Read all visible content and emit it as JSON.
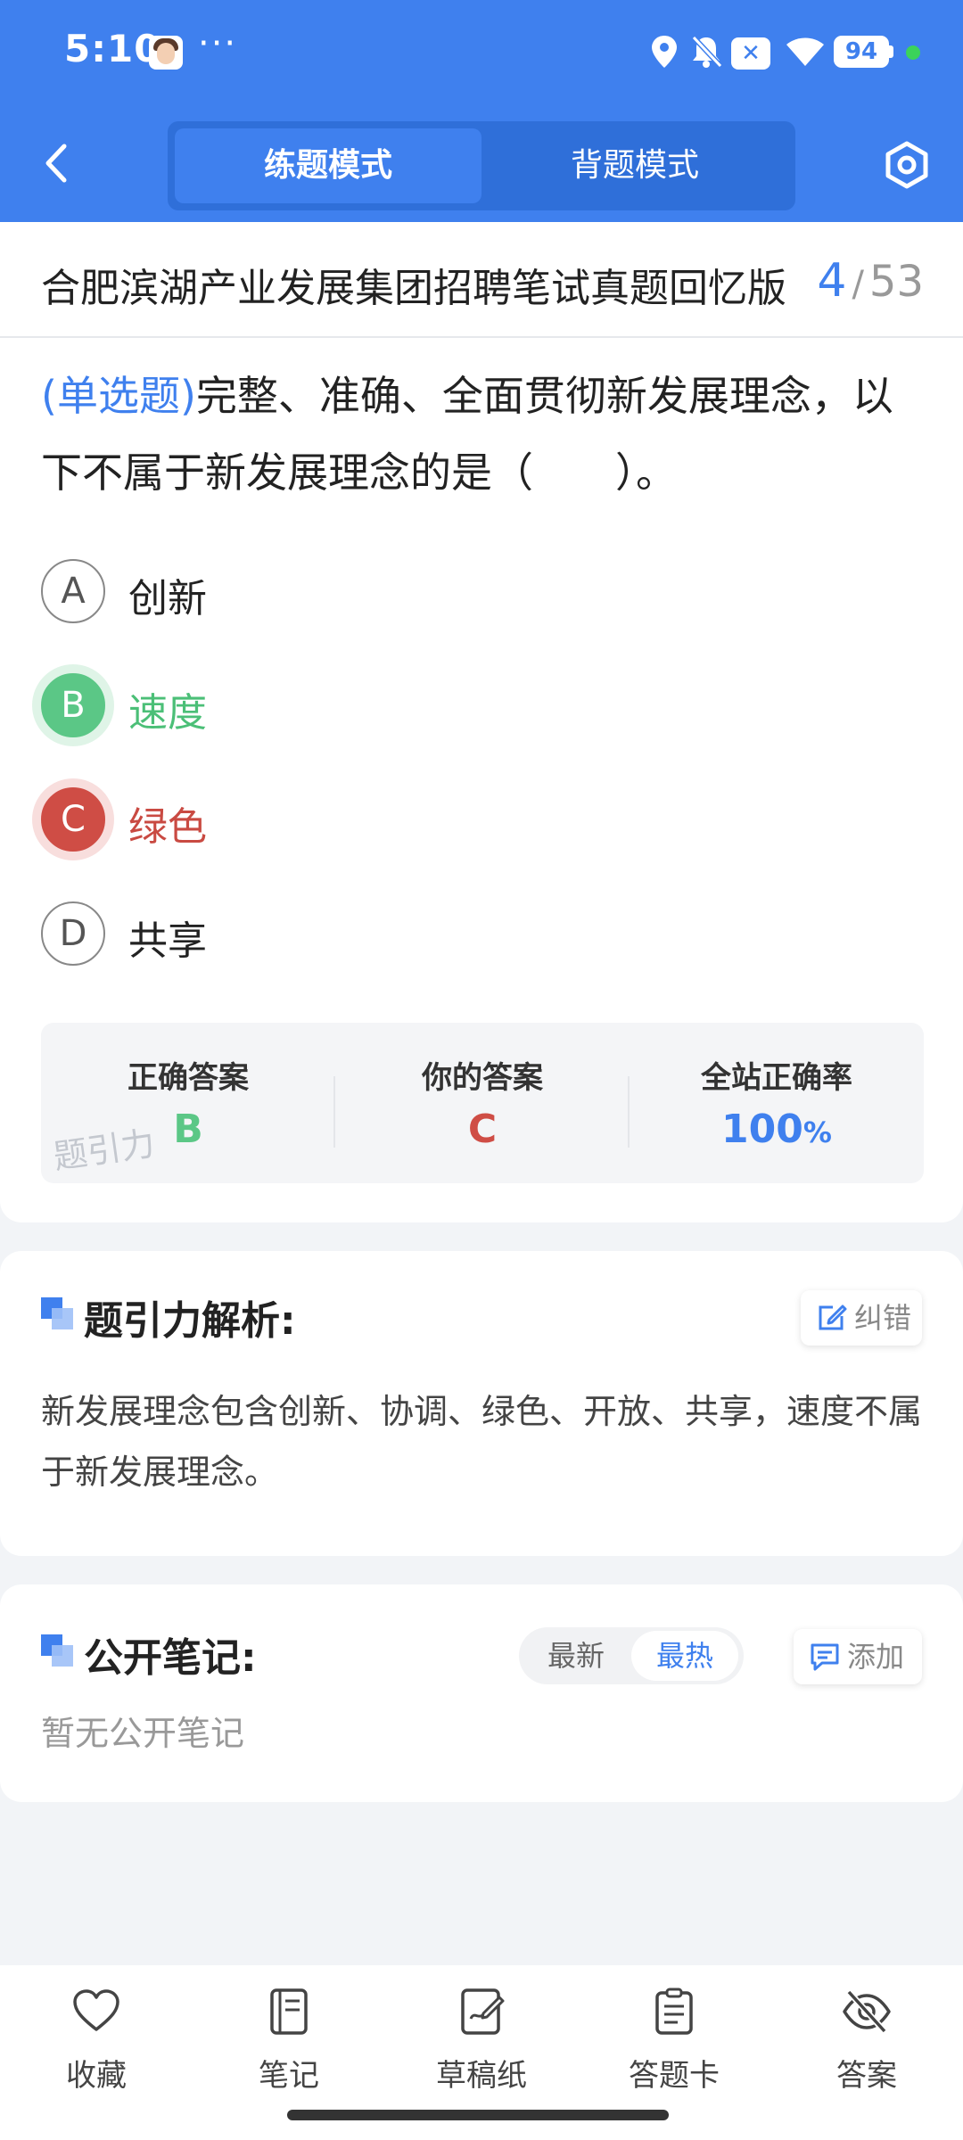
{
  "status_bar": {
    "time": "5:10",
    "more": "···",
    "x_badge": "✕",
    "battery": "94"
  },
  "header": {
    "tabs": [
      {
        "label": "练题模式",
        "active": true
      },
      {
        "label": "背题模式",
        "active": false
      }
    ]
  },
  "question_card": {
    "paper_title": "合肥滨湖产业发展集团招聘笔试真题回忆版",
    "current": "4",
    "separator": "/",
    "total": "53",
    "type": "(单选题)",
    "stem": "完整、准确、全面贯彻新发展理念，以下不属于新发展理念的是（　　）。",
    "options": [
      {
        "letter": "A",
        "text": "创新",
        "state": "normal"
      },
      {
        "letter": "B",
        "text": "速度",
        "state": "correct"
      },
      {
        "letter": "C",
        "text": "绿色",
        "state": "wrong"
      },
      {
        "letter": "D",
        "text": "共享",
        "state": "normal"
      }
    ],
    "answers": {
      "correct_label": "正确答案",
      "correct_value": "B",
      "yours_label": "你的答案",
      "yours_value": "C",
      "rate_label": "全站正确率",
      "rate_value": "100",
      "rate_unit": "%"
    },
    "watermark": "题引力"
  },
  "analysis": {
    "title": "题引力解析:",
    "report_button": "纠错",
    "text": "新发展理念包含创新、协调、绿色、开放、共享，速度不属于新发展理念。"
  },
  "notes": {
    "title": "公开笔记:",
    "sort_newest": "最新",
    "sort_hottest": "最热",
    "add_button": "添加",
    "empty_text": "暂无公开笔记"
  },
  "bottom_nav": [
    {
      "label": "收藏",
      "icon": "heart-icon"
    },
    {
      "label": "笔记",
      "icon": "notebook-icon"
    },
    {
      "label": "草稿纸",
      "icon": "draft-icon"
    },
    {
      "label": "答题卡",
      "icon": "answer-card-icon"
    },
    {
      "label": "答案",
      "icon": "eye-off-icon"
    }
  ],
  "colors": {
    "primary": "#3f80ee",
    "correct": "#5bc786",
    "wrong": "#cf4d45"
  }
}
